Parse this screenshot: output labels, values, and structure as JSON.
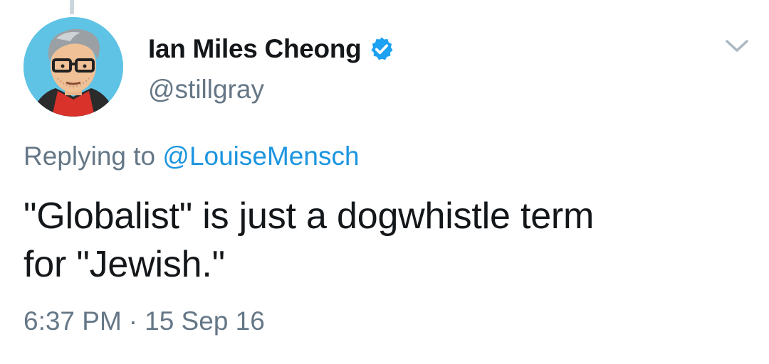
{
  "tweet": {
    "author": {
      "display_name": "Ian Miles Cheong",
      "handle": "@stillgray",
      "verified": true,
      "avatar_icon": "cartoon-avatar-icon"
    },
    "reply": {
      "prefix": "Replying to",
      "mention": "@LouiseMensch"
    },
    "text_line1": "\"Globalist\" is just a dogwhistle term",
    "text_line2": "for \"Jewish.\"",
    "time": "6:37 PM",
    "separator": "·",
    "date": "15 Sep 16"
  },
  "colors": {
    "text_primary": "#14171a",
    "text_secondary": "#657786",
    "link": "#1b95e0",
    "verified_badge": "#1da1f2",
    "thread_line": "#ccd6dd",
    "avatar_bg": "#5fc3e6"
  },
  "icons": {
    "verified": "verified-badge-icon",
    "more": "chevron-down-icon"
  }
}
